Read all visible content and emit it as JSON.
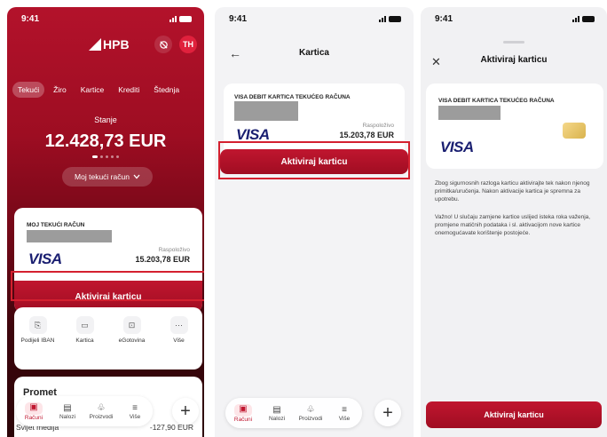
{
  "screen1": {
    "status_time": "9:41",
    "brand": "HPB",
    "avatar_initials": "TH",
    "tabs": [
      "Tekući",
      "Žiro",
      "Kartice",
      "Krediti",
      "Štednja"
    ],
    "balance_label": "Stanje",
    "balance": "12.428,73 EUR",
    "account_selector": "Moj tekući račun",
    "card": {
      "title": "MOJ TEKUĆI RAČUN",
      "brand": "VISA",
      "available_label": "Raspoloživo",
      "available": "15.203,78 EUR"
    },
    "activate_label": "Aktiviraj karticu",
    "quick_actions": [
      {
        "label": "Podijeli IBAN",
        "icon": "share-iban-icon"
      },
      {
        "label": "Kartica",
        "icon": "card-icon"
      },
      {
        "label": "eGotovina",
        "icon": "cash-icon"
      },
      {
        "label": "Više",
        "icon": "more-icon"
      }
    ],
    "promet_title": "Promet",
    "transaction": {
      "name": "Svijet medija",
      "amount": "-127,90 EUR"
    },
    "tabbar": [
      "Računi",
      "Nalozi",
      "Proizvodi",
      "Više"
    ]
  },
  "screen2": {
    "status_time": "9:41",
    "title": "Kartica",
    "card": {
      "title": "VISA DEBIT KARTICA TEKUĆEG RAČUNA",
      "brand": "VISA",
      "available_label": "Raspoloživo",
      "available": "15.203,78 EUR"
    },
    "activate_label": "Aktiviraj karticu",
    "tabbar": [
      "Računi",
      "Nalozi",
      "Proizvodi",
      "Više"
    ]
  },
  "screen3": {
    "status_time": "9:41",
    "title": "Aktiviraj karticu",
    "card": {
      "title": "VISA DEBIT KARTICA TEKUĆEG RAČUNA",
      "brand": "VISA"
    },
    "paragraph1": "Zbog sigurnosnih razloga karticu aktivirajte tek nakon njenog primitka/uručenja. Nakon aktivacije kartica je spremna za upotrebu.",
    "paragraph2": "Važno! U slučaju zamjene kartice uslijed isteka roka važenja, promjene matičnih podataka i sl. aktivacijom nove kartice onemogućavate korištenje postojeće.",
    "activate_label": "Aktiviraj karticu"
  },
  "colors": {
    "brand_red": "#b3122b",
    "visa_blue": "#1a1f71",
    "highlight": "#d4202f"
  }
}
